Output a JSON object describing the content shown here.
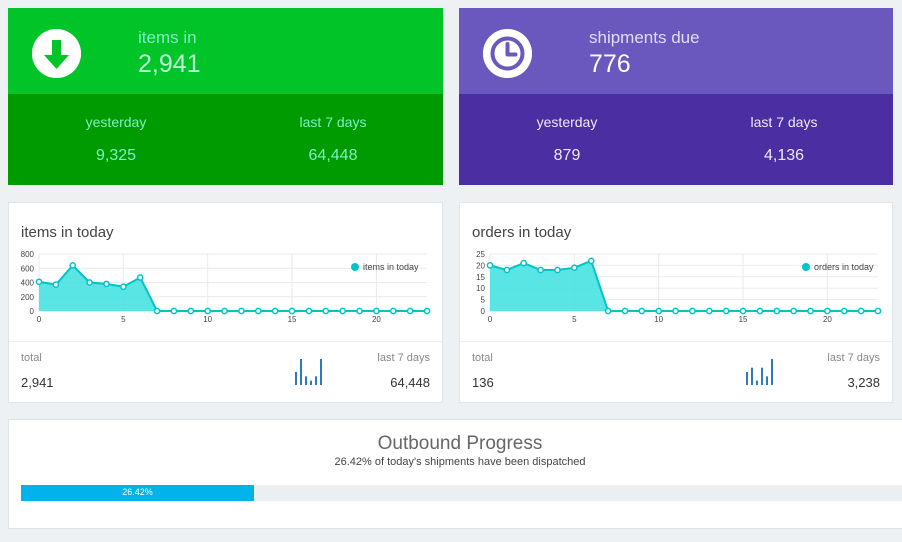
{
  "tiles": {
    "items": {
      "label": "items in",
      "value": "2,941",
      "icon": "arrow-down-circle-icon",
      "stats": [
        {
          "label": "yesterday",
          "value": "9,325"
        },
        {
          "label": "last 7 days",
          "value": "64,448"
        }
      ]
    },
    "shipments": {
      "label": "shipments due",
      "value": "776",
      "icon": "clock-icon",
      "stats": [
        {
          "label": "yesterday",
          "value": "879"
        },
        {
          "label": "last 7 days",
          "value": "4,136"
        }
      ]
    }
  },
  "panels": {
    "items": {
      "title": "items in today",
      "total_label": "total",
      "total_value": "2,941",
      "last7_label": "last 7 days",
      "last7_value": "64,448",
      "sparkline": [
        3,
        6,
        2,
        1,
        2,
        6
      ]
    },
    "orders": {
      "title": "orders in today",
      "total_label": "total",
      "total_value": "136",
      "last7_label": "last 7 days",
      "last7_value": "3,238",
      "sparkline": [
        3,
        4,
        1,
        4,
        2,
        6
      ]
    }
  },
  "progress": {
    "title": "Outbound Progress",
    "subtitle": "26.42% of today's shipments have been dispatched",
    "percent": 26.42,
    "label": "26.42%"
  },
  "colors": {
    "series": "#00c4c8",
    "series_fill": "#3de0e0",
    "sparkline": "#2d7bbf",
    "progress": "#00b3ea"
  },
  "chart_data": [
    {
      "type": "area",
      "title": "items in today",
      "x": [
        0,
        1,
        2,
        3,
        4,
        5,
        6,
        7,
        8,
        9,
        10,
        11,
        12,
        13,
        14,
        15,
        16,
        17,
        18,
        19,
        20,
        21,
        22,
        23
      ],
      "series": [
        {
          "name": "items in today",
          "values": [
            410,
            370,
            640,
            400,
            380,
            340,
            470,
            0,
            0,
            0,
            0,
            0,
            0,
            0,
            0,
            0,
            0,
            0,
            0,
            0,
            0,
            0,
            0,
            0
          ]
        }
      ],
      "ylim": [
        0,
        800
      ],
      "yticks": [
        0,
        200,
        400,
        600,
        800
      ],
      "xticks": [
        0,
        5,
        10,
        15,
        20
      ],
      "legend": "top-right",
      "grid": true
    },
    {
      "type": "area",
      "title": "orders in today",
      "x": [
        0,
        1,
        2,
        3,
        4,
        5,
        6,
        7,
        8,
        9,
        10,
        11,
        12,
        13,
        14,
        15,
        16,
        17,
        18,
        19,
        20,
        21,
        22,
        23
      ],
      "series": [
        {
          "name": "orders in today",
          "values": [
            20,
            18,
            21,
            18,
            18,
            19,
            22,
            0,
            0,
            0,
            0,
            0,
            0,
            0,
            0,
            0,
            0,
            0,
            0,
            0,
            0,
            0,
            0,
            0
          ]
        }
      ],
      "ylim": [
        0,
        25
      ],
      "yticks": [
        0,
        5,
        10,
        15,
        20,
        25
      ],
      "xticks": [
        0,
        5,
        10,
        15,
        20
      ],
      "legend": "top-right",
      "grid": true
    }
  ]
}
